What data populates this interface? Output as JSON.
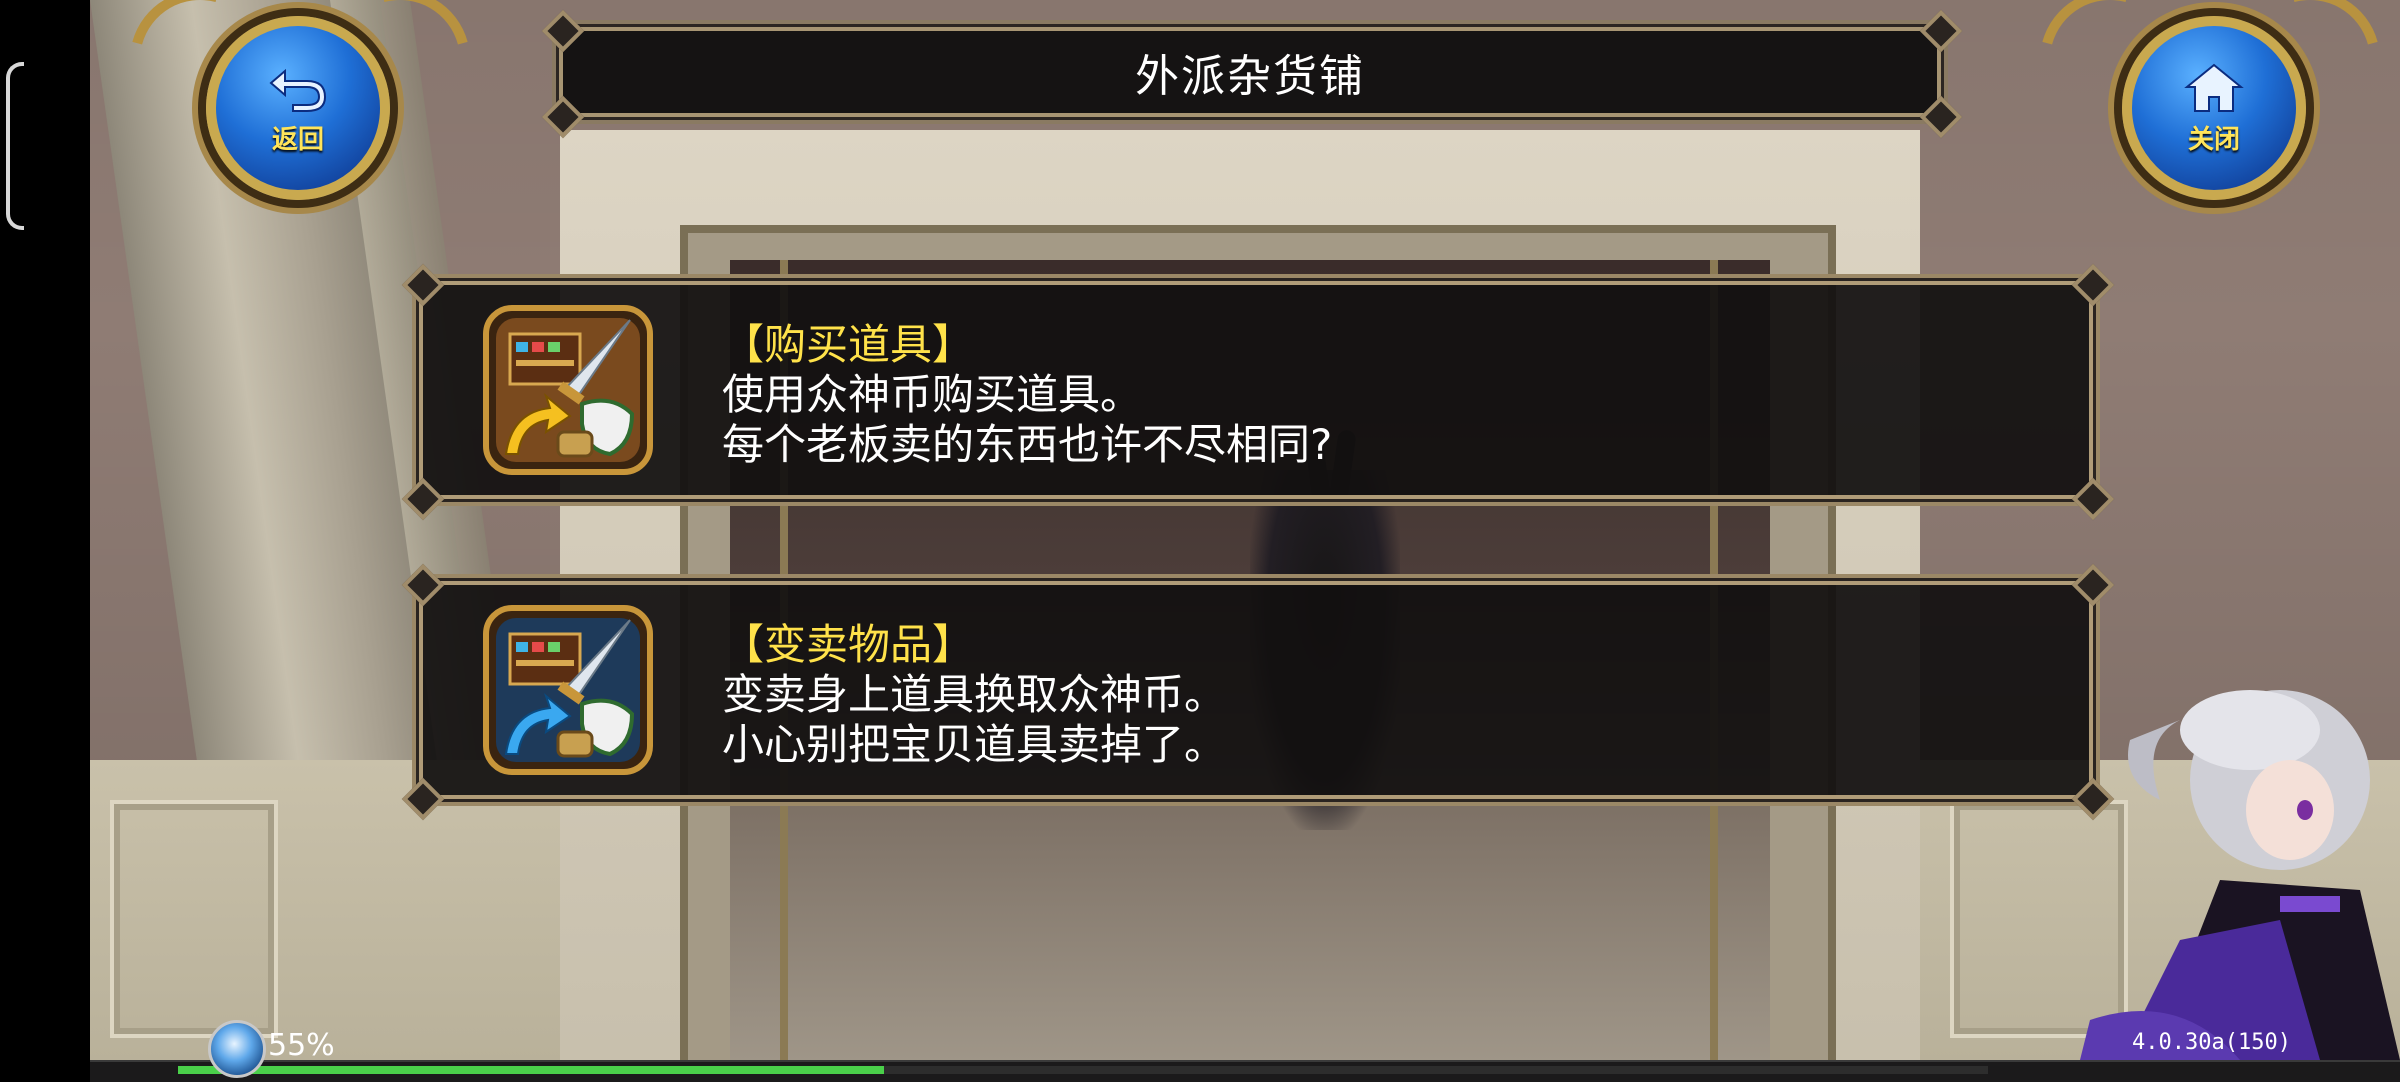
{
  "header": {
    "title": "外派杂货铺"
  },
  "buttons": {
    "back": {
      "label": "返回",
      "icon": "back-arrow-icon"
    },
    "close": {
      "label": "关闭",
      "icon": "home-icon"
    }
  },
  "options": [
    {
      "title": "【购买道具】",
      "lines": [
        "使用众神币购买道具。",
        "每个老板卖的东西也许不尽相同?"
      ],
      "icon": "buy-items-icon",
      "arrow_color": "#f5c020"
    },
    {
      "title": "【变卖物品】",
      "lines": [
        "变卖身上道具换取众神币。",
        "小心别把宝贝道具卖掉了。"
      ],
      "icon": "sell-items-icon",
      "arrow_color": "#3aa8f0"
    }
  ],
  "status": {
    "battery_percent_label": "55%",
    "version": "4.0.30a(150)",
    "progress": 0.39
  },
  "colors": {
    "title_yellow": "#ffe24a",
    "progress_green": "#4ad04a",
    "frame_gold": "#b09c78"
  }
}
